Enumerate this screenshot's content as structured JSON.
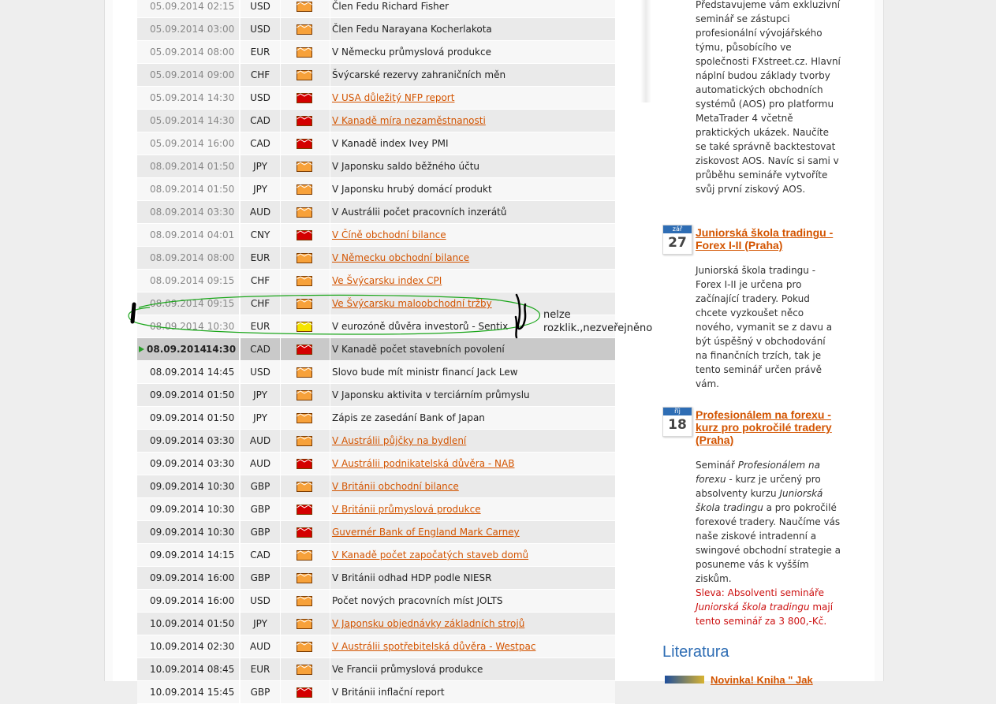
{
  "calendar": {
    "rows": [
      {
        "date": "05.09.2014",
        "time": "02:15",
        "currency": "USD",
        "importance": "medium",
        "event": "Člen Fedu Richard Fisher",
        "link": false,
        "state": "past"
      },
      {
        "date": "05.09.2014",
        "time": "03:00",
        "currency": "USD",
        "importance": "medium",
        "event": "Člen Fedu Narayana Kocherlakota",
        "link": false,
        "state": "past"
      },
      {
        "date": "05.09.2014",
        "time": "08:00",
        "currency": "EUR",
        "importance": "medium",
        "event": "V Německu průmyslová produkce",
        "link": false,
        "state": "past"
      },
      {
        "date": "05.09.2014",
        "time": "09:00",
        "currency": "CHF",
        "importance": "medium",
        "event": "Švýcarské rezervy zahraničních měn",
        "link": false,
        "state": "past"
      },
      {
        "date": "05.09.2014",
        "time": "14:30",
        "currency": "USD",
        "importance": "high",
        "event": "V USA důležitý NFP report",
        "link": true,
        "state": "past"
      },
      {
        "date": "05.09.2014",
        "time": "14:30",
        "currency": "CAD",
        "importance": "high",
        "event": "V Kanadě míra nezaměstnanosti",
        "link": true,
        "state": "past"
      },
      {
        "date": "05.09.2014",
        "time": "16:00",
        "currency": "CAD",
        "importance": "high",
        "event": "V Kanadě index Ivey PMI",
        "link": false,
        "state": "past"
      },
      {
        "date": "08.09.2014",
        "time": "01:50",
        "currency": "JPY",
        "importance": "medium",
        "event": "V Japonsku saldo běžného účtu",
        "link": false,
        "state": "past"
      },
      {
        "date": "08.09.2014",
        "time": "01:50",
        "currency": "JPY",
        "importance": "medium",
        "event": "V Japonsku hrubý domácí produkt",
        "link": false,
        "state": "past"
      },
      {
        "date": "08.09.2014",
        "time": "03:30",
        "currency": "AUD",
        "importance": "medium",
        "event": "V Austrálii počet pracovních inzerátů",
        "link": false,
        "state": "past"
      },
      {
        "date": "08.09.2014",
        "time": "04:01",
        "currency": "CNY",
        "importance": "high",
        "event": "V Číně obchodní bilance",
        "link": true,
        "state": "past"
      },
      {
        "date": "08.09.2014",
        "time": "08:00",
        "currency": "EUR",
        "importance": "medium",
        "event": "V Německu obchodní bilance",
        "link": true,
        "state": "past"
      },
      {
        "date": "08.09.2014",
        "time": "09:15",
        "currency": "CHF",
        "importance": "medium",
        "event": "Ve Švýcarsku index CPI",
        "link": true,
        "state": "past"
      },
      {
        "date": "08.09.2014",
        "time": "09:15",
        "currency": "CHF",
        "importance": "medium",
        "event": "Ve Švýcarsku maloobchodní tržby",
        "link": true,
        "state": "past"
      },
      {
        "date": "08.09.2014",
        "time": "10:30",
        "currency": "EUR",
        "importance": "low",
        "event": "V eurozóně důvěra investorů - Sentix",
        "link": false,
        "state": "past"
      },
      {
        "date": "08.09.2014",
        "time": "14:30",
        "currency": "CAD",
        "importance": "high",
        "event": "V Kanadě počet stavebních povolení",
        "link": false,
        "state": "current"
      },
      {
        "date": "08.09.2014",
        "time": "14:45",
        "currency": "USD",
        "importance": "medium",
        "event": "Slovo bude mít ministr financí Jack Lew",
        "link": false,
        "state": "future"
      },
      {
        "date": "09.09.2014",
        "time": "01:50",
        "currency": "JPY",
        "importance": "medium",
        "event": "V Japonsku aktivita v terciárním průmyslu",
        "link": false,
        "state": "future"
      },
      {
        "date": "09.09.2014",
        "time": "01:50",
        "currency": "JPY",
        "importance": "medium",
        "event": "Zápis ze zasedání Bank of Japan",
        "link": false,
        "state": "future"
      },
      {
        "date": "09.09.2014",
        "time": "03:30",
        "currency": "AUD",
        "importance": "medium",
        "event": "V Austrálii půjčky na bydlení",
        "link": true,
        "state": "future"
      },
      {
        "date": "09.09.2014",
        "time": "03:30",
        "currency": "AUD",
        "importance": "high",
        "event": "V Austrálii podnikatelská důvěra - NAB",
        "link": true,
        "state": "future"
      },
      {
        "date": "09.09.2014",
        "time": "10:30",
        "currency": "GBP",
        "importance": "medium",
        "event": "V Británii obchodní bilance",
        "link": true,
        "state": "future"
      },
      {
        "date": "09.09.2014",
        "time": "10:30",
        "currency": "GBP",
        "importance": "high",
        "event": "V Británii průmyslová produkce",
        "link": true,
        "state": "future"
      },
      {
        "date": "09.09.2014",
        "time": "10:30",
        "currency": "GBP",
        "importance": "high",
        "event": "Guvernér Bank of England Mark Carney",
        "link": true,
        "state": "future"
      },
      {
        "date": "09.09.2014",
        "time": "14:15",
        "currency": "CAD",
        "importance": "medium",
        "event": "V Kanadě počet započatých staveb domů",
        "link": true,
        "state": "future"
      },
      {
        "date": "09.09.2014",
        "time": "16:00",
        "currency": "GBP",
        "importance": "medium",
        "event": "V Británii odhad HDP podle NIESR",
        "link": false,
        "state": "future"
      },
      {
        "date": "09.09.2014",
        "time": "16:00",
        "currency": "USD",
        "importance": "medium",
        "event": "Počet nových pracovních míst JOLTS",
        "link": false,
        "state": "future"
      },
      {
        "date": "10.09.2014",
        "time": "01:50",
        "currency": "JPY",
        "importance": "medium",
        "event": "V Japonsku objednávky základních strojů",
        "link": true,
        "state": "future"
      },
      {
        "date": "10.09.2014",
        "time": "02:30",
        "currency": "AUD",
        "importance": "medium",
        "event": "V Austrálii spotřebitelská důvěra - Westpac",
        "link": true,
        "state": "future"
      },
      {
        "date": "10.09.2014",
        "time": "08:45",
        "currency": "EUR",
        "importance": "medium",
        "event": "Ve Francii průmyslová produkce",
        "link": false,
        "state": "future"
      },
      {
        "date": "10.09.2014",
        "time": "15:45",
        "currency": "GBP",
        "importance": "high",
        "event": "V Británii inflační report",
        "link": false,
        "state": "future"
      }
    ],
    "importance_colors": {
      "high": "#d40000",
      "medium": "#f7a13a",
      "low": "#f5e400"
    }
  },
  "annotation": {
    "line1": "nelze",
    "line2": "rozklik.,nezveřejněno",
    "marker_color": "#1aa61a"
  },
  "sidebar": {
    "intro_text": "Představujeme vám exkluzivní seminář se zástupci profesionální vývojářského týmu, působícího ve společnosti FXstreet.cz. Hlavní náplní budou základy tvorby automatických obchodních systémů (AOS) pro platformu MetaTrader 4 včetně praktických ukázek. Naučíte se také správně backtestovat ziskovost AOS. Navíc si sami v průběhu semináře vytvoříte svůj první ziskový AOS.",
    "events": [
      {
        "month": "zář",
        "day": "27",
        "title": "Juniorská škola tradingu - Forex I-II (Praha)",
        "description": "Juniorská škola tradingu - Forex I-II je určena pro začínající tradery. Pokud chcete vyzkoušet něco nového, vymanit se z davu a být úspěšný v obchodování na finančních trzích, tak je tento seminář určen právě vám."
      },
      {
        "month": "říj",
        "day": "18",
        "title": "Profesionálem na forexu - kurz pro pokročilé tradery (Praha)",
        "desc_part1": "Seminář ",
        "desc_italic1": "Profesionálem na forexu",
        "desc_part2": " - kurz je určený pro absolventy kurzu ",
        "desc_italic2": "Juniorská škola tradingu",
        "desc_part3": " a pro pokročilé forexové tradery. Naučíme vás naše ziskové intradenní a swingové obchodní strategie a posuneme vás k vyšším ziskům.",
        "discount_part1": "Sleva: Absolventi semináře ",
        "discount_italic": "Juniorská škola tradingu",
        "discount_part2": " mají tento seminář za 3 800,-Kč."
      }
    ],
    "literature_heading": "Literatura",
    "book_link": "Novinka! Kniha \" Jak"
  }
}
